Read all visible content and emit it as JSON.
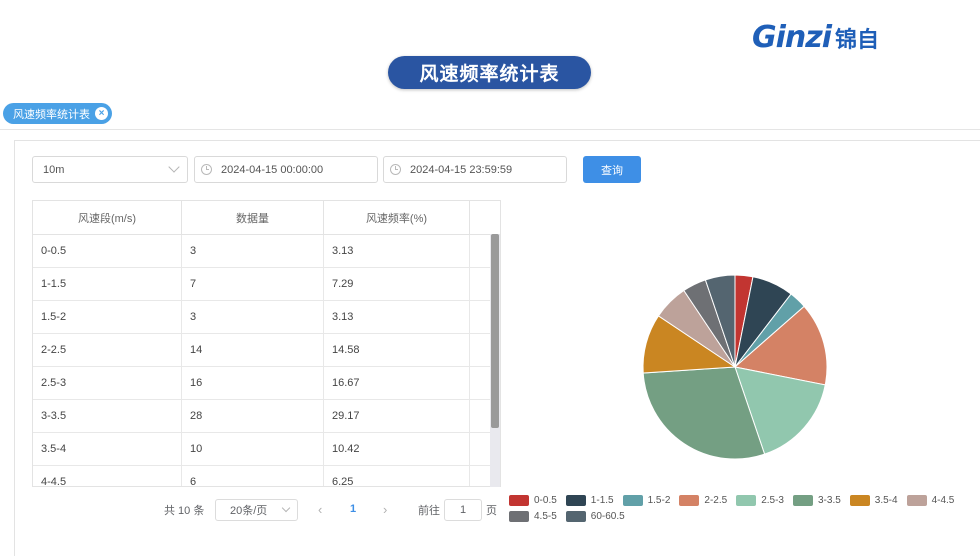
{
  "brand": {
    "logo_en": "Ginzi",
    "logo_cn": "锦自"
  },
  "page_title": "风速频率统计表",
  "tab": {
    "label": "风速频率统计表",
    "close_symbol": "×"
  },
  "filters": {
    "interval": "10m",
    "start_time": "2024-04-15 00:00:00",
    "end_time": "2024-04-15 23:59:59",
    "query_label": "查询"
  },
  "table": {
    "headers": [
      "风速段(m/s)",
      "数据量",
      "风速频率(%)"
    ],
    "rows": [
      [
        "0-0.5",
        "3",
        "3.13"
      ],
      [
        "1-1.5",
        "7",
        "7.29"
      ],
      [
        "1.5-2",
        "3",
        "3.13"
      ],
      [
        "2-2.5",
        "14",
        "14.58"
      ],
      [
        "2.5-3",
        "16",
        "16.67"
      ],
      [
        "3-3.5",
        "28",
        "29.17"
      ],
      [
        "3.5-4",
        "10",
        "10.42"
      ],
      [
        "4-4.5",
        "6",
        "6.25"
      ]
    ]
  },
  "pagination": {
    "total": "共 10 条",
    "page_size": "20条/页",
    "prev": "‹",
    "current": "1",
    "next": "›",
    "goto_label": "前往",
    "goto_value": "1",
    "goto_suffix": "页"
  },
  "chart_data": {
    "type": "pie",
    "slices": [
      {
        "label": "0-0.5",
        "value": 3.13,
        "color": "#c23531"
      },
      {
        "label": "1-1.5",
        "value": 7.29,
        "color": "#2f4554"
      },
      {
        "label": "1.5-2",
        "value": 3.13,
        "color": "#61a0a8"
      },
      {
        "label": "2-2.5",
        "value": 14.58,
        "color": "#d48265"
      },
      {
        "label": "2.5-3",
        "value": 16.67,
        "color": "#91c7ae"
      },
      {
        "label": "3-3.5",
        "value": 29.17,
        "color": "#749f83"
      },
      {
        "label": "3.5-4",
        "value": 10.42,
        "color": "#ca8622"
      },
      {
        "label": "4-4.5",
        "value": 6.25,
        "color": "#bda29a"
      },
      {
        "label": "4.5-5",
        "value": 4.17,
        "color": "#6e7074"
      },
      {
        "label": "60-60.5",
        "value": 5.21,
        "color": "#546570"
      }
    ],
    "legend_position": "bottom"
  }
}
